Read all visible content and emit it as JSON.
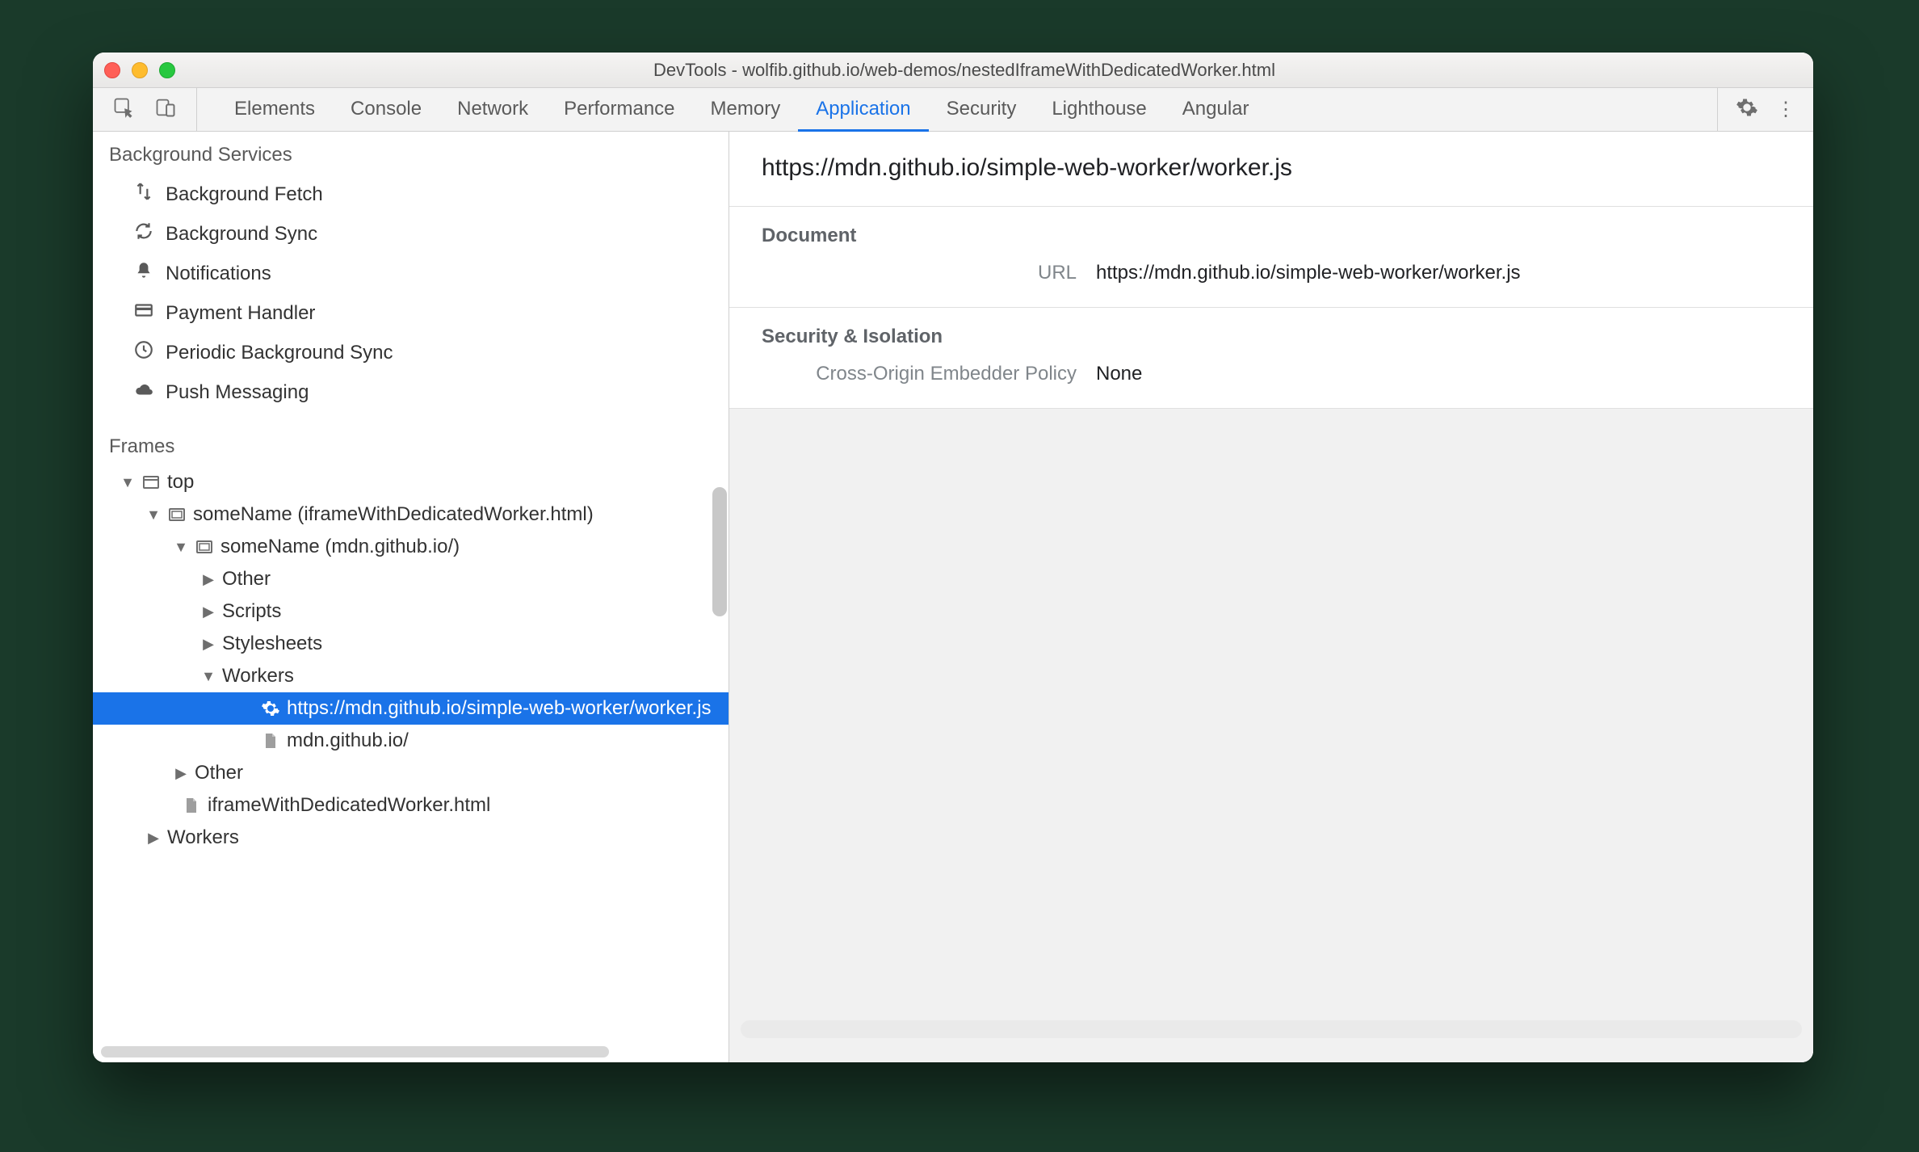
{
  "window": {
    "title": "DevTools - wolfib.github.io/web-demos/nestedIframeWithDedicatedWorker.html"
  },
  "tabs": {
    "items": [
      "Elements",
      "Console",
      "Network",
      "Performance",
      "Memory",
      "Application",
      "Security",
      "Lighthouse",
      "Angular"
    ],
    "active": "Application"
  },
  "sidebar": {
    "bg_title": "Background Services",
    "bg_items": [
      {
        "icon": "updown",
        "label": "Background Fetch"
      },
      {
        "icon": "sync",
        "label": "Background Sync"
      },
      {
        "icon": "bell",
        "label": "Notifications"
      },
      {
        "icon": "card",
        "label": "Payment Handler"
      },
      {
        "icon": "clock",
        "label": "Periodic Background Sync"
      },
      {
        "icon": "cloud",
        "label": "Push Messaging"
      }
    ],
    "frames_title": "Frames",
    "tree": {
      "top": "top",
      "iframe1": "someName (iframeWithDedicatedWorker.html)",
      "iframe2": "someName (mdn.github.io/)",
      "other1": "Other",
      "scripts": "Scripts",
      "stylesheets": "Stylesheets",
      "workers": "Workers",
      "worker_js": "https://mdn.github.io/simple-web-worker/worker.js",
      "mdn_root": "mdn.github.io/",
      "other2": "Other",
      "iframe_file": "iframeWithDedicatedWorker.html",
      "workers2": "Workers"
    }
  },
  "main": {
    "title": "https://mdn.github.io/simple-web-worker/worker.js",
    "document": {
      "section": "Document",
      "url_label": "URL",
      "url_value": "https://mdn.github.io/simple-web-worker/worker.js"
    },
    "security": {
      "section": "Security & Isolation",
      "coep_label": "Cross-Origin Embedder Policy",
      "coep_value": "None"
    }
  }
}
